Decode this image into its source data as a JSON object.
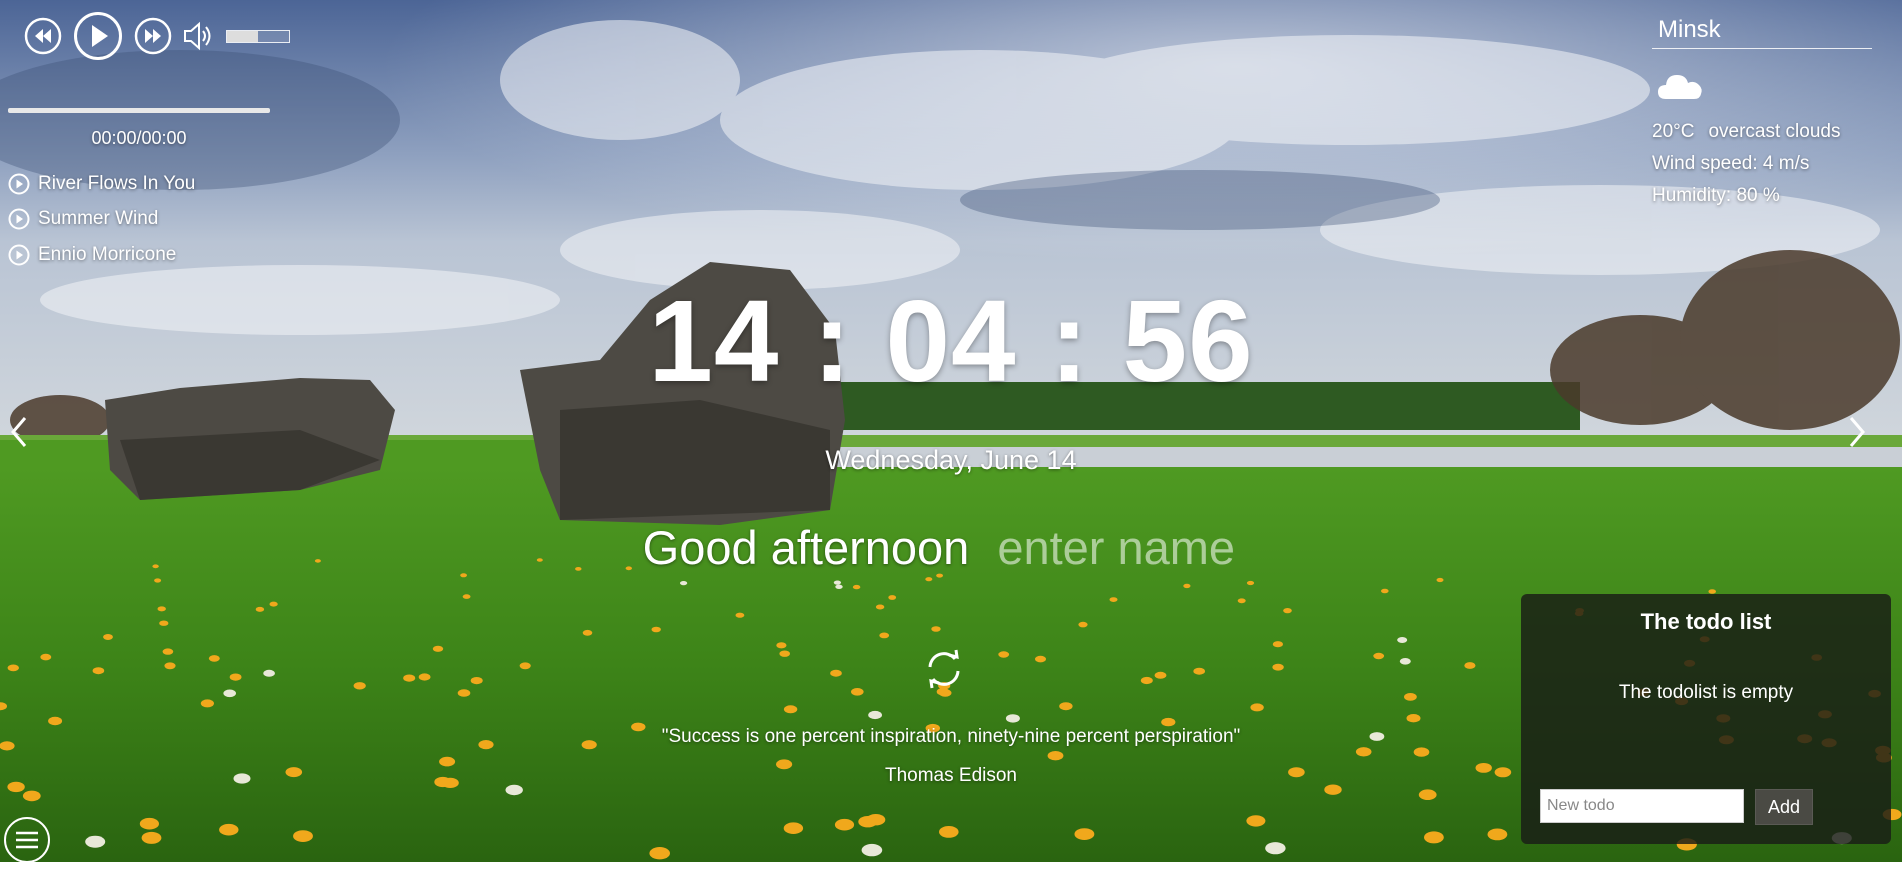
{
  "player": {
    "time": "00:00/00:00",
    "volume_level": 0.5,
    "progress_level": 0,
    "tracks": [
      {
        "title": "River Flows In You"
      },
      {
        "title": "Summer Wind"
      },
      {
        "title": "Ennio Morricone"
      }
    ]
  },
  "weather": {
    "city": "Minsk",
    "temperature": "20°C",
    "description": "overcast clouds",
    "wind": "Wind speed: 4 m/s",
    "humidity": "Humidity: 80 %",
    "icon": "cloud-icon"
  },
  "clock": {
    "time": "14 : 04 : 56",
    "date": "Wednesday, June 14"
  },
  "greeting": {
    "text": "Good afternoon",
    "name_placeholder": "enter name"
  },
  "quote": {
    "text": "\"Success is one percent inspiration, ninety-nine percent perspiration\"",
    "author": "Thomas Edison"
  },
  "todo": {
    "title": "The todo list",
    "empty_message": "The todolist is empty",
    "input_placeholder": "New todo",
    "add_label": "Add"
  },
  "colors": {
    "sky": "#5a79a8",
    "grass": "#3f8a1c",
    "todo_bg": "#191c16",
    "flower": "#f0a81c"
  }
}
